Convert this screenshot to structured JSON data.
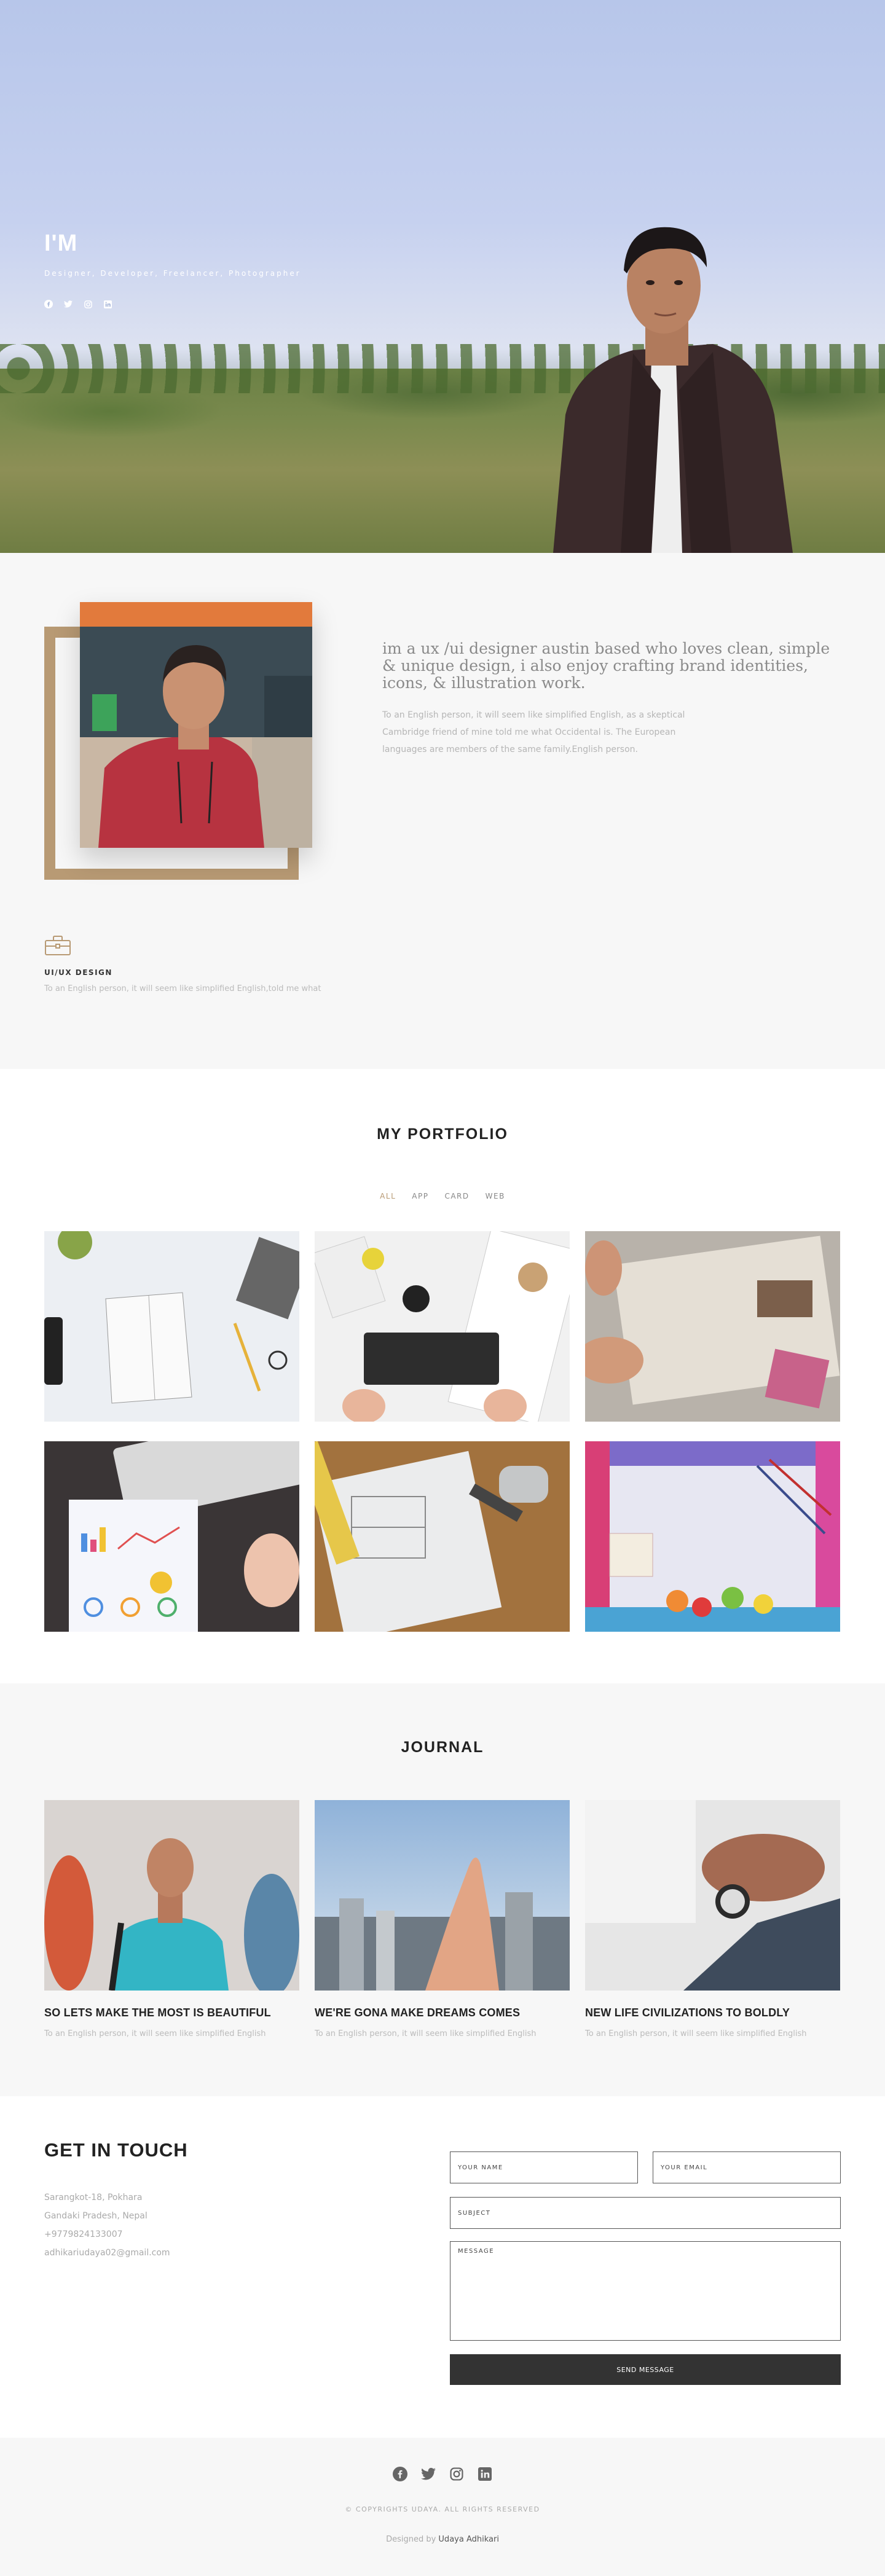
{
  "hero": {
    "title": "I'M",
    "subtitle": "Designer, Developer, Freelancer, Photographer",
    "social": [
      "facebook-icon",
      "twitter-icon",
      "instagram-icon",
      "linkedin-icon"
    ]
  },
  "about": {
    "heading": "im a ux /ui designer austin based who loves clean, simple & unique design, i also enjoy crafting brand identities, icons, & illustration work.",
    "body": "To an English person, it will seem like simplified English, as a skeptical Cambridge friend of mine told me what Occidental is. The European languages are members of the same family.English person.",
    "service": {
      "icon": "briefcase-icon",
      "title": "UI/UX DESIGN",
      "text": "To an English person, it will seem like simplified English,told me what"
    }
  },
  "portfolio": {
    "title": "MY PORTFOLIO",
    "filters": [
      {
        "label": "ALL",
        "active": true
      },
      {
        "label": "APP",
        "active": false
      },
      {
        "label": "CARD",
        "active": false
      },
      {
        "label": "WEB",
        "active": false
      }
    ]
  },
  "journal": {
    "title": "JOURNAL",
    "posts": [
      {
        "title": "SO LETS MAKE THE MOST IS BEAUTIFUL",
        "text": "To an English person, it will seem like simplified English"
      },
      {
        "title": "WE'RE GONA MAKE DREAMS COMES",
        "text": "To an English person, it will seem like simplified English"
      },
      {
        "title": "NEW LIFE CIVILIZATIONS TO BOLDLY",
        "text": "To an English person, it will seem like simplified English"
      }
    ]
  },
  "contact": {
    "title": "GET IN TOUCH",
    "address_line1": "Sarangkot-18, Pokhara",
    "address_line2": "Gandaki Pradesh, Nepal",
    "phone": "+9779824133007",
    "email": "adhikariudaya02@gmail.com",
    "form": {
      "name_placeholder": "YOUR NAME",
      "email_placeholder": "YOUR EMAIL",
      "subject_placeholder": "SUBJECT",
      "message_placeholder": "MESSAGE",
      "send_label": "SEND MESSAGE"
    }
  },
  "footer": {
    "social": [
      "facebook-icon",
      "twitter-icon",
      "instagram-icon",
      "linkedin-icon"
    ],
    "copyright": "© COPYRIGHTS UDAYA. ALL RIGHTS RESERVED",
    "designed_by": "Designed by",
    "designer": "Udaya Adhikari"
  },
  "colors": {
    "accent": "#b89a74",
    "dark_button": "#333333",
    "section_bg": "#f7f7f7"
  }
}
